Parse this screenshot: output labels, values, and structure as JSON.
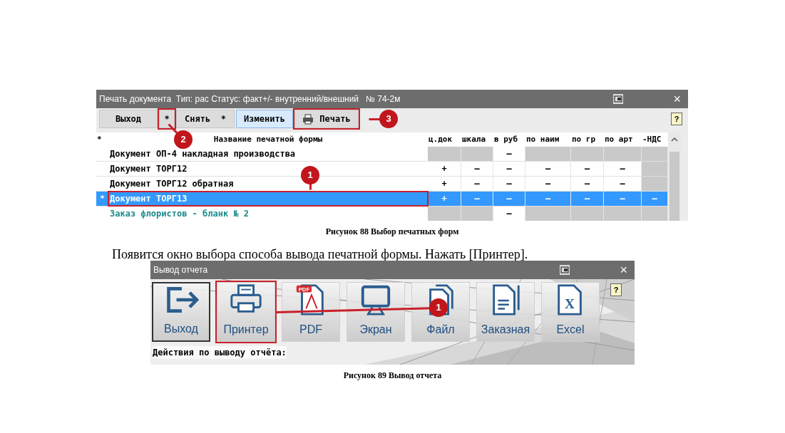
{
  "figure_88": {
    "window": {
      "title": "Печать документа  Тип: рас Статус: факт+/- внутренний/внешний   № 74-2м",
      "close": "×"
    },
    "toolbar": [
      {
        "label": "Выход",
        "kind": "plain",
        "highlighted": false
      },
      {
        "label": "*",
        "kind": "plain",
        "highlighted": true,
        "callout": "2"
      },
      {
        "label": "Снять  *",
        "kind": "plain",
        "highlighted": false
      },
      {
        "label": "Изменить",
        "kind": "active",
        "highlighted": false
      },
      {
        "label": "Печать",
        "kind": "print",
        "highlighted": true,
        "callout": "3"
      }
    ],
    "help": "?",
    "table": {
      "columns": [
        "*",
        "Название печатной формы",
        "ц.док",
        "шкала",
        "в руб",
        "по наим",
        "по гр",
        "по арт",
        "-НДС"
      ],
      "rows": [
        {
          "kind": "document",
          "selected": false,
          "highlighted": false,
          "cells": [
            "",
            "Документ ОП-4 накладная производства",
            "",
            "",
            "–",
            "",
            "",
            "",
            ""
          ],
          "disabled": [
            false,
            false,
            true,
            true,
            false,
            true,
            true,
            true,
            true
          ]
        },
        {
          "kind": "document",
          "selected": false,
          "highlighted": false,
          "cells": [
            "",
            "Документ ТОРГ12",
            "+",
            "–",
            "–",
            "–",
            "–",
            "–",
            ""
          ],
          "disabled": [
            false,
            false,
            false,
            false,
            false,
            false,
            false,
            false,
            true
          ]
        },
        {
          "kind": "document",
          "selected": false,
          "highlighted": false,
          "cells": [
            "",
            "Документ ТОРГ12 обратная",
            "+",
            "–",
            "–",
            "–",
            "–",
            "–",
            ""
          ],
          "disabled": [
            false,
            false,
            false,
            false,
            false,
            false,
            false,
            false,
            true
          ]
        },
        {
          "kind": "document",
          "selected": true,
          "highlighted": true,
          "callout": "1",
          "cells": [
            "*",
            "Документ ТОРГ13",
            "+",
            "–",
            "–",
            "–",
            "–",
            "–",
            "–"
          ],
          "disabled": [
            false,
            false,
            false,
            false,
            false,
            false,
            false,
            false,
            false
          ]
        },
        {
          "kind": "template",
          "selected": false,
          "highlighted": false,
          "cells": [
            "",
            "Заказ флористов - бланк № 2",
            "",
            "",
            "–",
            "",
            "",
            "",
            ""
          ],
          "disabled": [
            false,
            false,
            true,
            true,
            false,
            true,
            true,
            true,
            true
          ]
        }
      ]
    },
    "caption": "Рисунок 88 Выбор печатных форм"
  },
  "paragraph": "Появится окно выбора способа вывода печатной формы. Нажать [Принтер].",
  "figure_89": {
    "window": {
      "title": "Вывод отчета",
      "close": "×"
    },
    "buttons": [
      {
        "label": "Выход",
        "kind": "exit",
        "selected": true,
        "highlighted": false
      },
      {
        "label": "Принтер",
        "kind": "printer",
        "selected": false,
        "highlighted": true,
        "callout": "1"
      },
      {
        "label": "PDF",
        "kind": "pdf",
        "tag": "PDF",
        "selected": false,
        "highlighted": false
      },
      {
        "label": "Экран",
        "kind": "screen",
        "selected": false,
        "highlighted": false
      },
      {
        "label": "Файл",
        "kind": "file",
        "selected": false,
        "highlighted": false
      },
      {
        "label": "Заказная",
        "kind": "custom",
        "selected": false,
        "highlighted": false
      },
      {
        "label": "Excel",
        "kind": "excel",
        "tag": "X",
        "selected": false,
        "highlighted": false
      }
    ],
    "help": "?",
    "status": "Действия по выводу отчёта:",
    "caption": "Рисунок 89 Вывод отчета"
  }
}
